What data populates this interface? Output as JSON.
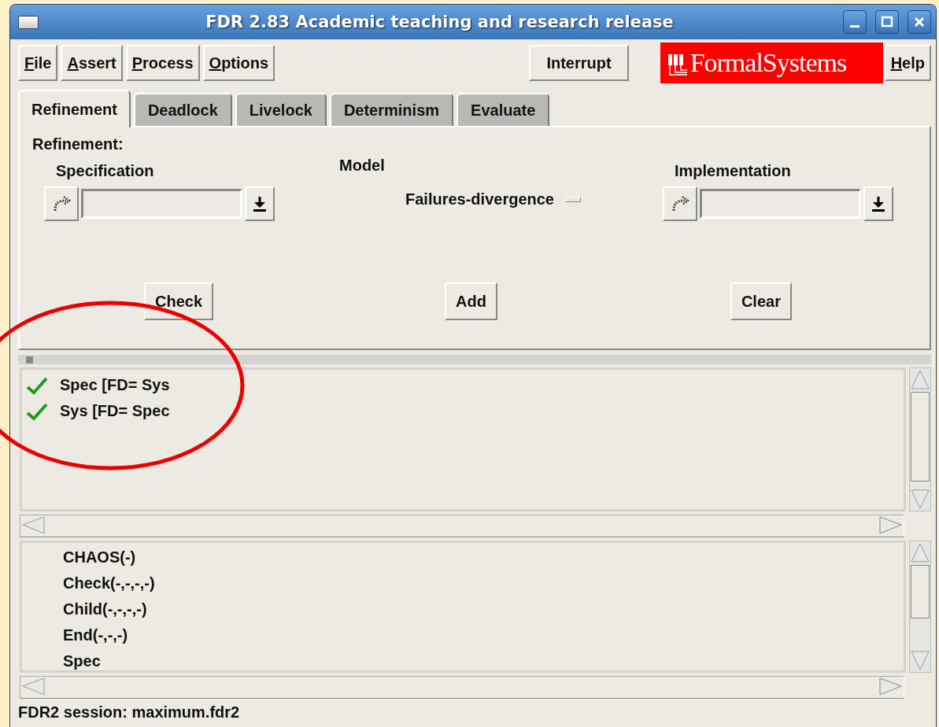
{
  "window": {
    "title": "FDR 2.83 Academic teaching and research release"
  },
  "menu": [
    "File",
    "Assert",
    "Process",
    "Options"
  ],
  "interrupt_button": "Interrupt",
  "logo": "FormalSystems",
  "help_menu": "Help",
  "tabs": [
    {
      "label": "Refinement",
      "selected": true
    },
    {
      "label": "Deadlock",
      "selected": false
    },
    {
      "label": "Livelock",
      "selected": false
    },
    {
      "label": "Determinism",
      "selected": false
    },
    {
      "label": "Evaluate",
      "selected": false
    }
  ],
  "refinement": {
    "heading": "Refinement:",
    "specification": {
      "label": "Specification"
    },
    "model": {
      "label": "Model",
      "value": "Failures-divergence"
    },
    "implementation": {
      "label": "Implementation"
    },
    "buttons": [
      "Check",
      "Add",
      "Clear"
    ]
  },
  "results": [
    {
      "text": "Spec [FD= Sys",
      "passed": true
    },
    {
      "text": "Sys [FD= Spec",
      "passed": true
    }
  ],
  "processes": [
    "CHAOS(-)",
    "Check(-,-,-,-)",
    "Child(-,-,-,-)",
    "End(-,-,-)",
    "Spec"
  ],
  "status_bar": "FDR2 session: maximum.fdr2"
}
